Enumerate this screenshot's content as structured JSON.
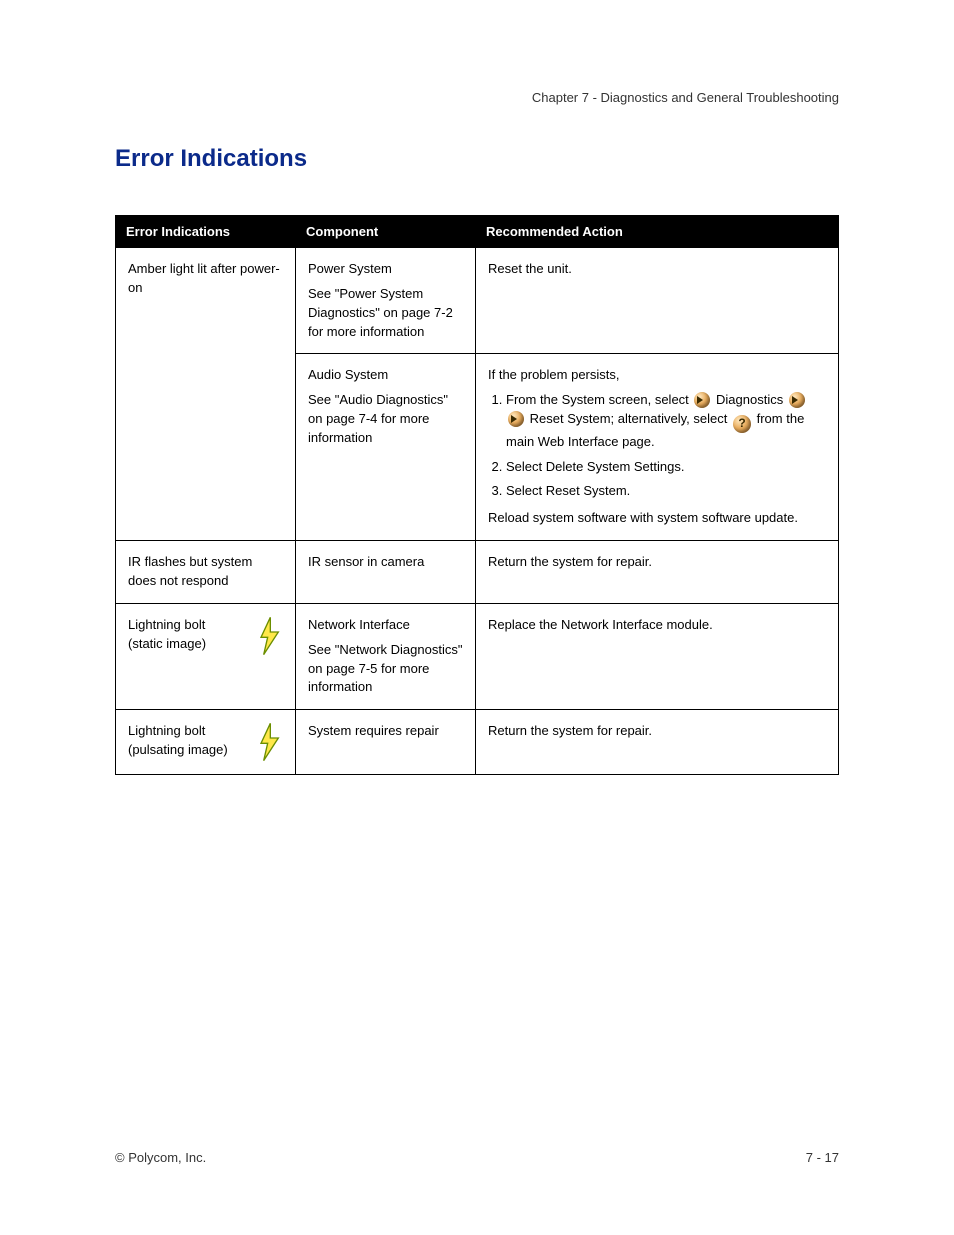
{
  "header": {
    "breadcrumb": "Chapter 7 - Diagnostics and General Troubleshooting"
  },
  "section": {
    "title": "Error Indications"
  },
  "table": {
    "headers": {
      "indication": "Error Indications",
      "component": "Component",
      "action": "Recommended Action"
    },
    "rows": [
      {
        "indication": "Amber light lit after power-on",
        "component_a": {
          "label": "Power System",
          "sub": "See \"Power System Diagnostics\" on page 7-2 for more information"
        },
        "component_b": {
          "label": "Audio System",
          "sub": "See \"Audio Diagnostics\" on page 7-4 for more information"
        },
        "action_a": "Reset the unit.",
        "action_steps_lead": "If the problem persists,",
        "action_step1_pre": "From the System screen, select ",
        "action_step1_mid": "Diagnostics",
        "action_step1_mid2": "Reset System",
        "action_step1_post": "alternatively, select ",
        "action_step1_help": " from the main Web Interface page.",
        "action_step2": "Select Delete System Settings.",
        "action_step3": "Select Reset System.",
        "action_b": "Reload system software with system software update."
      },
      {
        "indication": "IR flashes but system does not respond",
        "component": {
          "label": "IR sensor in camera"
        },
        "action": "Return the system for repair."
      },
      {
        "indication": {
          "label": "Lightning bolt",
          "sub": "(static image)"
        },
        "component": {
          "label": "Network Interface",
          "sub": "See \"Network Diagnostics\" on page 7-5 for more information"
        },
        "action": "Replace the Network Interface module."
      },
      {
        "indication": {
          "label": "Lightning bolt",
          "sub": "(pulsating image)"
        },
        "component": {
          "label": "System requires repair"
        },
        "action": "Return the system for repair."
      }
    ]
  },
  "footer": {
    "copyright": "© Polycom, Inc.",
    "pageno": "7 - 17"
  }
}
